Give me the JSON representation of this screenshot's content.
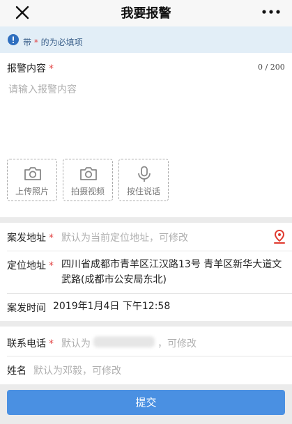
{
  "header": {
    "title": "我要报警",
    "close_icon": "close-icon",
    "more_icon": "more-icon"
  },
  "notice": {
    "prefix": "带",
    "star": "*",
    "suffix": "的为必填项",
    "icon": "info-icon",
    "color": "#e2eef7"
  },
  "report": {
    "label": "报警内容",
    "required": "*",
    "counter": "0 / 200",
    "placeholder": "请输入报警内容"
  },
  "media": [
    {
      "label": "上传照片",
      "icon": "camera-icon"
    },
    {
      "label": "拍摄视频",
      "icon": "camera-icon"
    },
    {
      "label": "按住说话",
      "icon": "microphone-icon"
    }
  ],
  "incident_address": {
    "label": "案发地址",
    "required": "*",
    "placeholder": "默认为当前定位地址，可修改",
    "icon": "location-pin-icon"
  },
  "located_address": {
    "label": "定位地址",
    "required": "*",
    "value_line1": "四川省成都市青羊区江汉路13号 青羊区新华大道文",
    "value_line2": "武路(成都市公安局东北)"
  },
  "incident_time": {
    "label": "案发时间",
    "value": "2019年1月4日 下午12:58"
  },
  "phone": {
    "label": "联系电话",
    "required": "*",
    "placeholder_prefix": "默认为",
    "placeholder_suffix": "，可修改"
  },
  "name": {
    "label": "姓名",
    "placeholder": "默认为邓毅，可修改"
  },
  "submit": {
    "label": "提交",
    "color": "#4a90e2"
  }
}
